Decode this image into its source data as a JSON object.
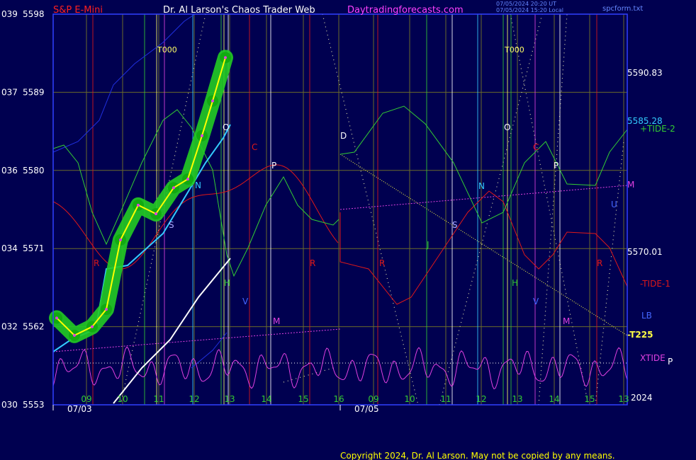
{
  "header": {
    "instrument": "S&P E-Mini",
    "site_title": "Dr. Al Larson's Chaos Trader Web",
    "site_url": "Daytradingforecasts.com",
    "timestamp_ut": "07/05/2024 20:20 UT",
    "timestamp_local": "07/05/2024 15:20 Local",
    "file": "spcform.txt"
  },
  "colors": {
    "background": "#000050",
    "frame": "#3040ff",
    "grid": "#6a6a2a",
    "instrument": "#ff2020",
    "title": "#ffffff",
    "url": "#ff40ff",
    "price_band": "#22cc22",
    "price_line": "#ffff00",
    "cyan_curve": "#33ccff",
    "red_curve": "#e01818",
    "green_curve": "#33cc33",
    "magenta": "#e040e0",
    "blue_curve": "#2030e0",
    "white_curve": "#ffffff"
  },
  "left_axis": [
    {
      "angle": "039",
      "price": "5598"
    },
    {
      "angle": "037",
      "price": "5589"
    },
    {
      "angle": "036",
      "price": "5580"
    },
    {
      "angle": "034",
      "price": "5571"
    },
    {
      "angle": "032",
      "price": "5562"
    },
    {
      "angle": "030",
      "price": "5553"
    }
  ],
  "right_labels": {
    "price_high": "5590.83",
    "price_mid": "5585.28",
    "price_low": "5570.01",
    "tide2": "+TIDE-2",
    "tide1": "-TIDE-1",
    "m": "M",
    "lb": "LB",
    "t225": "-T225",
    "xtide": "XTIDE",
    "p": "P",
    "year": "2024",
    "u": "U"
  },
  "x_axis": {
    "hours": [
      "09",
      "10",
      "11",
      "12",
      "13",
      "14",
      "15",
      "16",
      "09",
      "10",
      "11",
      "12",
      "13",
      "14",
      "15",
      "13"
    ],
    "dates": [
      "07/03",
      "07/05"
    ]
  },
  "markers": {
    "t000_left": "T000",
    "t000_right": "T000",
    "letters": [
      "O",
      "C",
      "P",
      "N",
      "S",
      "R",
      "H",
      "V",
      "M",
      "R",
      "R",
      "J",
      "N",
      "S",
      "O",
      "C",
      "P",
      "H",
      "V",
      "M",
      "R",
      "D"
    ]
  },
  "footer": {
    "copyright": "Copyright 2024, Dr. Al Larson. May not be copied by any means."
  },
  "chart_data": {
    "type": "line",
    "title": "S&P E-Mini",
    "ylim": [
      5553,
      5598
    ],
    "y_ticks": [
      5553,
      5562,
      5571,
      5580,
      5589,
      5598
    ],
    "x_categories": [
      "07/03 09",
      "07/03 10",
      "07/03 11",
      "07/03 12",
      "07/03 13",
      "07/03 14",
      "07/03 15",
      "07/03 16",
      "07/05 09",
      "07/05 10",
      "07/05 11",
      "07/05 12",
      "07/05 13",
      "07/05 14",
      "07/05 15"
    ],
    "series": [
      {
        "values": [
          5563,
          5561,
          5562,
          5564,
          5572,
          5576,
          5575,
          5578,
          5579,
          5584,
          5588,
          5593
        ]
      }
    ],
    "legend": "none"
  }
}
